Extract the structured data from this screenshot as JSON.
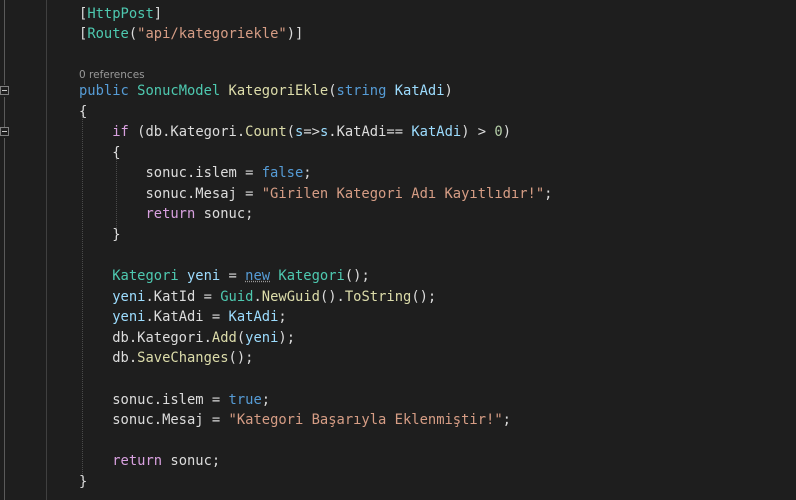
{
  "editor": {
    "codelens_references": "0 references",
    "lines": {
      "l1_attr": "HttpPost",
      "l2_attr": "Route",
      "l2_str": "\"api/kategoriekle\"",
      "l3_kw": "public",
      "l3_type": "SonucModel",
      "l3_method": "KategoriEkle",
      "l3_ptype": "string",
      "l3_param": "KatAdi",
      "l5_if": "if",
      "l5_a": "(db.Kategori.",
      "l5_count": "Count",
      "l5_b": "(",
      "l5_s1": "s",
      "l5_c": "=>",
      "l5_s2": "s",
      "l5_d": ".KatAdi== ",
      "l5_p": "KatAdi",
      "l5_e": ") > ",
      "l5_zero": "0",
      "l5_f": ")",
      "l7_a": "sonuc.islem = ",
      "l7_false": "false",
      "l8_a": "sonuc.Mesaj = ",
      "l8_str": "\"Girilen Kategori Adı Kayıtlıdır!\"",
      "l9_ret": "return",
      "l9_a": " sonuc;",
      "l11_type": "Kategori",
      "l11_var": "yeni",
      "l11_new": "new",
      "l11_type2": "Kategori",
      "l12_var": "yeni",
      "l12_a": ".KatId = ",
      "l12_guid": "Guid",
      "l12_newguid": "NewGuid",
      "l12_tostring": "ToString",
      "l13_var": "yeni",
      "l13_a": ".KatAdi = ",
      "l13_p": "KatAdi",
      "l14_a": "db.Kategori.",
      "l14_add": "Add",
      "l14_var": "yeni",
      "l15_a": "db.",
      "l15_save": "SaveChanges",
      "l17_a": "sonuc.islem = ",
      "l17_true": "true",
      "l18_a": "sonuc.Mesaj = ",
      "l18_str": "\"Kategori Başarıyla Eklenmiştir!\"",
      "l20_ret": "return",
      "l20_a": " sonuc;"
    }
  },
  "colors": {
    "background": "#1e1e1e",
    "keyword": "#569cd6",
    "control": "#d8a0df",
    "type": "#4ec9b0",
    "string": "#d69d85",
    "method": "#dcdcaa",
    "local": "#9cdcfe",
    "number": "#b5cea8",
    "plain": "#dcdcdc"
  }
}
